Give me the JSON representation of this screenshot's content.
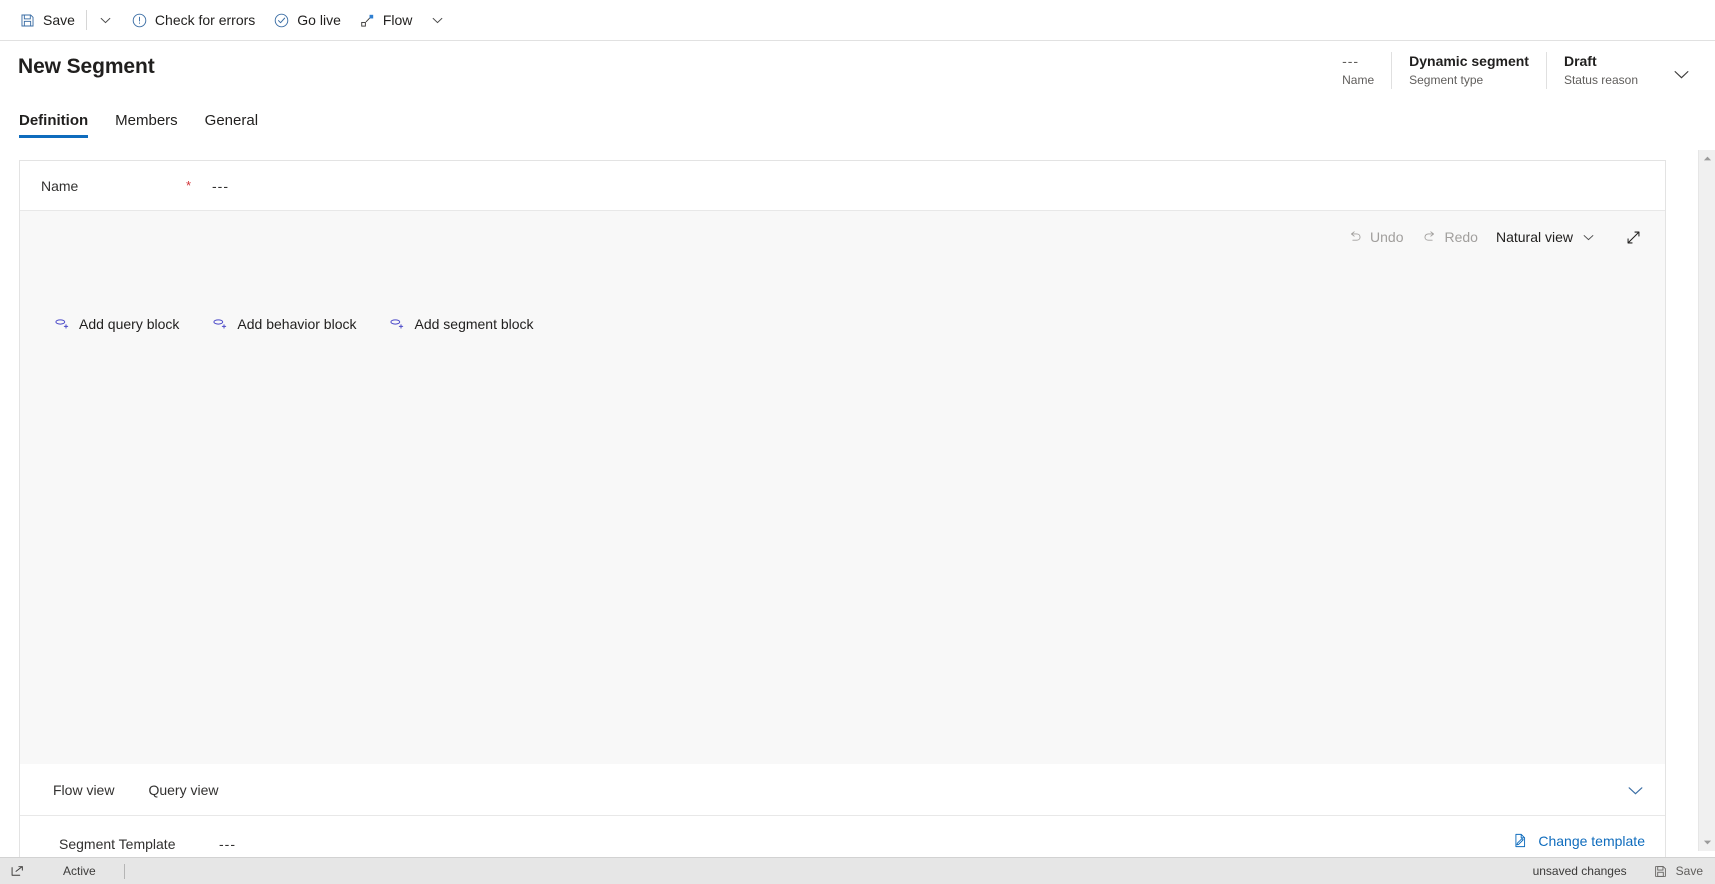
{
  "commandbar": {
    "items": [
      {
        "label": "Save",
        "icon": "save-icon"
      },
      {
        "label": "Check for errors",
        "icon": "error-circle-icon"
      },
      {
        "label": "Go live",
        "icon": "checkmark-circle-icon"
      },
      {
        "label": "Flow",
        "icon": "flow-icon"
      }
    ],
    "save_dropdown_icon": "chevron-down-icon",
    "flow_dropdown_icon": "chevron-down-icon"
  },
  "header": {
    "title": "New Segment",
    "fields": [
      {
        "value": "---",
        "label": "Name"
      },
      {
        "value": "Dynamic segment",
        "label": "Segment type"
      },
      {
        "value": "Draft",
        "label": "Status reason"
      }
    ],
    "expand_icon": "chevron-down-icon"
  },
  "tabs": [
    {
      "label": "Definition",
      "active": true
    },
    {
      "label": "Members",
      "active": false
    },
    {
      "label": "General",
      "active": false
    }
  ],
  "form": {
    "name_label": "Name",
    "required_marker": "*",
    "name_value": "---"
  },
  "canvas": {
    "toolbar": {
      "undo_label": "Undo",
      "undo_icon": "undo-icon",
      "redo_label": "Redo",
      "redo_icon": "redo-icon",
      "view_label": "Natural view",
      "view_chevron_icon": "chevron-down-icon",
      "expand_icon": "expand-diagonal-icon"
    },
    "blocks": [
      {
        "label": "Add query block",
        "icon": "add-query-icon"
      },
      {
        "label": "Add behavior block",
        "icon": "add-behavior-icon"
      },
      {
        "label": "Add segment block",
        "icon": "add-segment-icon"
      }
    ]
  },
  "flowsection": {
    "tabs": [
      {
        "label": "Flow view"
      },
      {
        "label": "Query view"
      }
    ],
    "collapse_icon": "chevron-down-icon",
    "template_label": "Segment Template",
    "template_value": "---",
    "change_template_label": "Change template",
    "change_template_icon": "page-edit-icon"
  },
  "statusbar": {
    "pop_out_icon": "pop-out-icon",
    "state": "Active",
    "unsaved": "unsaved changes",
    "save_label": "Save",
    "save_icon": "save-icon"
  },
  "scrollbar": {
    "up_icon": "triangle-up-icon",
    "down_icon": "triangle-down-icon"
  },
  "colors": {
    "accent": "#0f6cbd",
    "link": "#0f6cbd",
    "required": "#d13438",
    "text": "#201f1e",
    "subtle": "#605e5c",
    "disabled": "#a19f9d",
    "canvas_bg": "#f8f8f8",
    "statusbar_bg": "#e6e6e6"
  }
}
